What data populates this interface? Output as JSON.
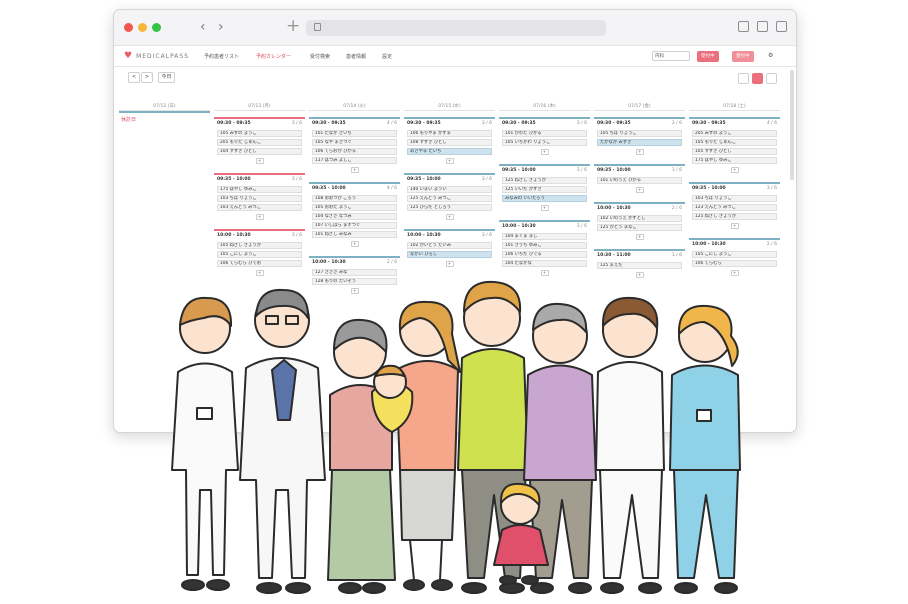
{
  "app": {
    "logo": "MEDICALPASS",
    "nav": [
      "予約患者リスト",
      "予約カレンダー",
      "受付検索",
      "患者情報",
      "設定"
    ],
    "select_value": "内科",
    "buttons": [
      "受付中",
      "受付中"
    ]
  },
  "toolbar": {
    "prev": "<",
    "next": ">",
    "today": "今日"
  },
  "days": [
    {
      "label": "07/12 (日)",
      "event": "休診日",
      "slots": []
    },
    {
      "label": "07/13 (月)",
      "event": "",
      "slots": [
        {
          "time": "09:30 - 09:35",
          "cap": "3 / 6",
          "accent": "pink",
          "patients": [
            "105 みずの  ようこ",
            "205 もりた  じゅんこ",
            "104 すずき  ひとし"
          ],
          "hl": []
        },
        {
          "time": "09:35 - 10:00",
          "cap": "3 / 6",
          "accent": "pink",
          "patients": [
            "175 はやし  ゆみこ",
            "103 ちば  りょうこ",
            "103 えんどう  みつこ"
          ],
          "hl": []
        },
        {
          "time": "10:00 - 10:30",
          "cap": "3 / 6",
          "accent": "pink",
          "patients": [
            "105 ねぎし  きょうか",
            "105 こにし  ようこ",
            "106 てらむら  ひでお"
          ],
          "hl": []
        }
      ]
    },
    {
      "label": "07/14 (火)",
      "event": "",
      "slots": [
        {
          "time": "09:30 - 09:35",
          "cap": "4 / 6",
          "accent": "blue",
          "patients": [
            "101 たなか  さいち",
            "105 なや  まさつぐ",
            "106 てらおか  ひかる",
            "117 はつみ  よしこ"
          ],
          "hl": []
        },
        {
          "time": "09:35 - 10:00",
          "cap": "4 / 6",
          "accent": "blue",
          "patients": [
            "108 おおつか  ごろう",
            "105 おおた  ようこ",
            "104 なぎさ  なつみ",
            "107 いしはら  ますつぐ",
            "101 ねぎし  みなみ"
          ],
          "hl": []
        },
        {
          "time": "10:00 - 10:30",
          "cap": "2 / 6",
          "accent": "blue",
          "patients": [
            "127 さささ  みな",
            "128 もりの  たいぞう"
          ],
          "hl": []
        }
      ]
    },
    {
      "label": "07/15 (水)",
      "event": "",
      "slots": [
        {
          "time": "09:30 - 09:35",
          "cap": "3 / 6",
          "accent": "blue",
          "patients": [
            "106 もりやま  かずま",
            "108 すずき  ひとし",
            "あさやま  たいち"
          ],
          "hl": [
            2
          ]
        },
        {
          "time": "09:35 - 10:00",
          "cap": "3 / 6",
          "accent": "blue",
          "patients": [
            "140 いまい  ようい",
            "125 えんどう  みつこ",
            "125 ひらだ  としろう"
          ],
          "hl": []
        },
        {
          "time": "10:00 - 10:30",
          "cap": "3 / 6",
          "accent": "blue",
          "patients": [
            "102 かいとう  たいみ",
            "なかい  ひろし"
          ],
          "hl": [
            1
          ]
        }
      ]
    },
    {
      "label": "07/16 (木)",
      "event": "",
      "slots": [
        {
          "time": "09:30 - 09:35",
          "cap": "3 / 6",
          "accent": "blue",
          "patients": [
            "101 かわた  ひかる",
            "105 いちかわ  りょうこ"
          ],
          "hl": []
        },
        {
          "time": "09:35 - 10:00",
          "cap": "3 / 6",
          "accent": "blue",
          "patients": [
            "125 ねぎし  きょうか",
            "125 いいだ  かずき",
            "みなみの  いいたろう"
          ],
          "hl": [
            2
          ]
        },
        {
          "time": "10:00 - 10:30",
          "cap": "3 / 6",
          "accent": "blue",
          "patients": [
            "104 まくま  まし",
            "101 きうち  ゆみこ",
            "106 いちだ  ひでる",
            "104 たなかな"
          ],
          "hl": []
        }
      ]
    },
    {
      "label": "07/17 (金)",
      "event": "",
      "slots": [
        {
          "time": "09:30 - 09:35",
          "cap": "2 / 6",
          "accent": "blue",
          "patients": [
            "105 ちば  りょうこ",
            "たかなか  みずき"
          ],
          "hl": [
            1
          ]
        },
        {
          "time": "09:35 - 10:00",
          "cap": "1 / 6",
          "accent": "blue",
          "patients": [
            "101 いのうえ  ひかる"
          ],
          "hl": []
        },
        {
          "time": "10:00 - 10:30",
          "cap": "2 / 6",
          "accent": "blue",
          "patients": [
            "102 いのうえ  かずとし",
            "125 かとう  まなこ"
          ],
          "hl": []
        },
        {
          "time": "10:30 - 11:00",
          "cap": "1 / 6",
          "accent": "blue",
          "patients": [
            "125 まえだ"
          ],
          "hl": []
        }
      ]
    },
    {
      "label": "07/18 (土)",
      "event": "",
      "slots": [
        {
          "time": "09:30 - 09:35",
          "cap": "4 / 6",
          "accent": "blue",
          "patients": [
            "205 みずの  ようこ",
            "105 もりた  じゅんこ",
            "105 すずき  ひとし",
            "175 はやし  ゆみこ"
          ],
          "hl": []
        },
        {
          "time": "09:35 - 10:00",
          "cap": "3 / 6",
          "accent": "blue",
          "patients": [
            "103 ちば  りょうこ",
            "123 えんどう  みつこ",
            "125 ねぎし  きょうか"
          ],
          "hl": []
        },
        {
          "time": "10:00 - 10:30",
          "cap": "2 / 6",
          "accent": "blue",
          "patients": [
            "105 こにし  ようこ",
            "106 てらむら"
          ],
          "hl": []
        }
      ]
    }
  ]
}
